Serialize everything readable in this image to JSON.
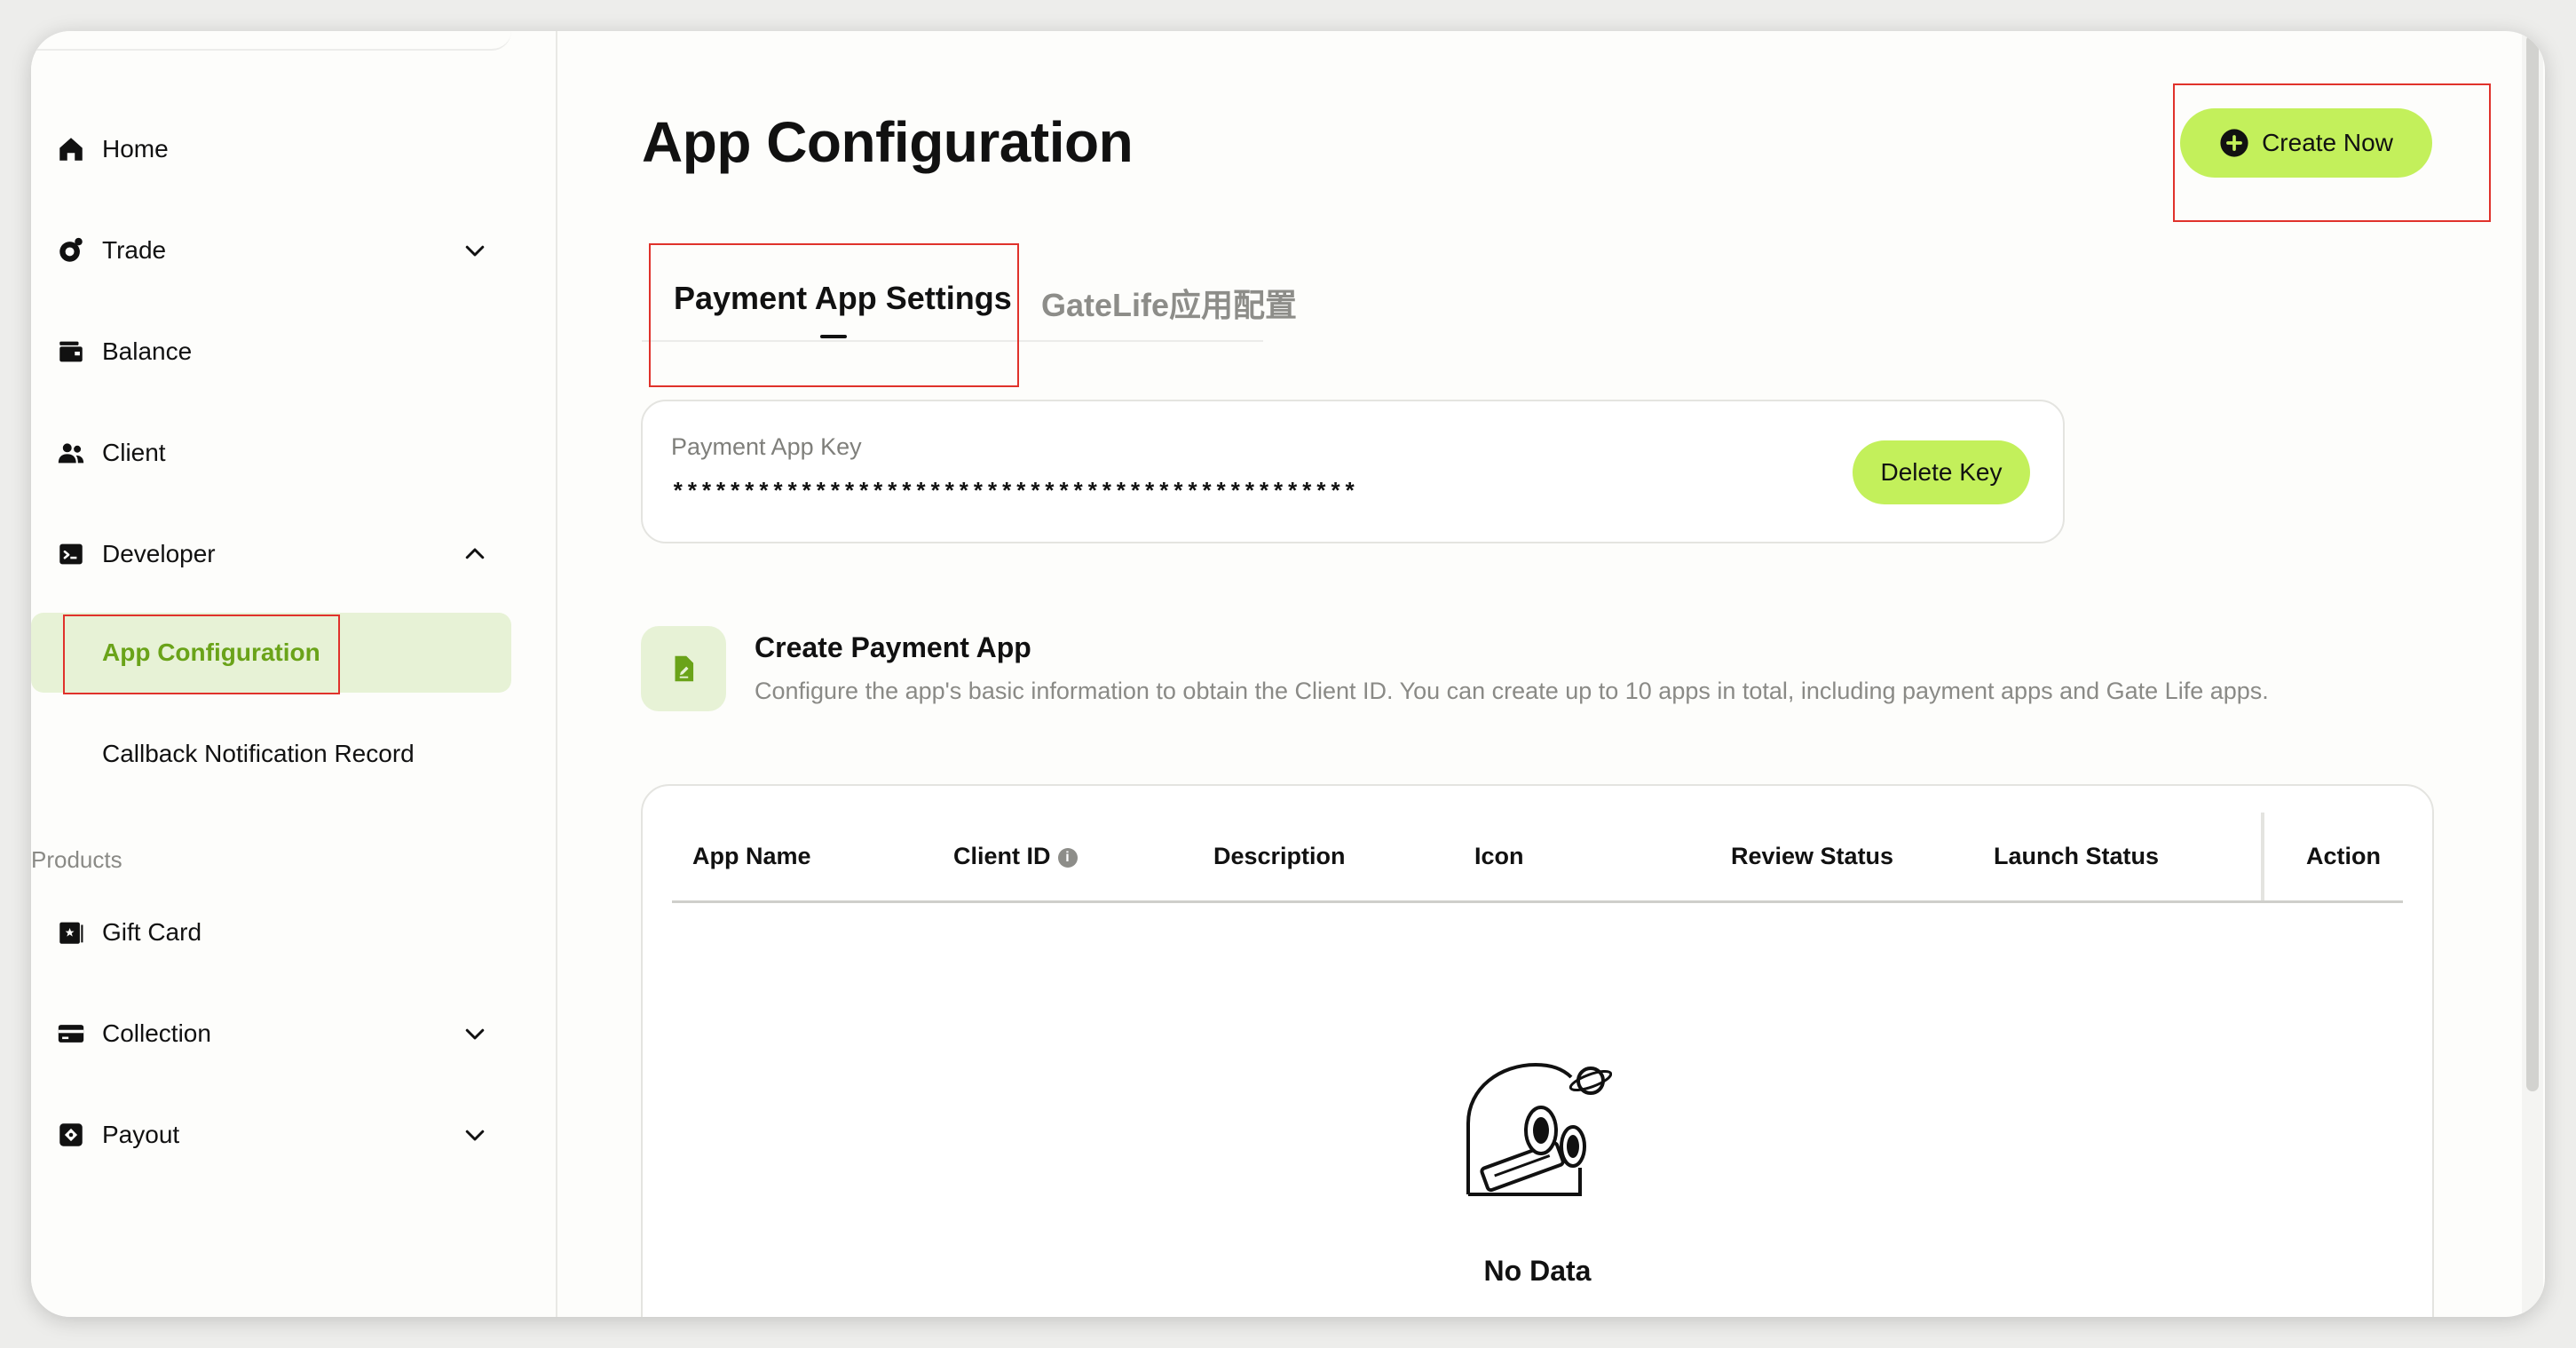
{
  "sidebar": {
    "items": [
      {
        "label": "Home",
        "icon": "home-icon"
      },
      {
        "label": "Trade",
        "icon": "trade-icon",
        "chevron": "chevron-down-icon"
      },
      {
        "label": "Balance",
        "icon": "wallet-icon"
      },
      {
        "label": "Client",
        "icon": "users-icon"
      },
      {
        "label": "Developer",
        "icon": "terminal-icon",
        "chevron": "chevron-up-icon"
      }
    ],
    "developer_sub": [
      {
        "label": "App Configuration",
        "active": true
      },
      {
        "label": "Callback Notification Record",
        "active": false
      }
    ],
    "products_label": "Products",
    "products": [
      {
        "label": "Gift Card",
        "icon": "gift-card-icon"
      },
      {
        "label": "Collection",
        "icon": "collection-icon",
        "chevron": "chevron-down-icon"
      },
      {
        "label": "Payout",
        "icon": "payout-icon",
        "chevron": "chevron-down-icon"
      }
    ]
  },
  "main": {
    "title": "App Configuration",
    "create_button": "Create Now",
    "tabs": [
      {
        "label": "Payment App Settings",
        "active": true
      },
      {
        "label": "GateLife应用配置",
        "active": false
      }
    ],
    "key_card": {
      "label": "Payment App Key",
      "value": "************************************************",
      "delete_button": "Delete Key"
    },
    "create_app": {
      "title": "Create Payment App",
      "description": "Configure the app's basic information to obtain the Client ID. You can create up to 10 apps in total, including payment apps and Gate Life apps."
    },
    "table": {
      "columns": [
        "App Name",
        "Client ID",
        "Description",
        "Icon",
        "Review Status",
        "Launch Status",
        "Action"
      ],
      "empty_text": "No Data"
    }
  },
  "colors": {
    "accent": "#c3f05b",
    "active_bg": "#e7f2d6",
    "active_text": "#6aa319",
    "highlight_box": "#e0322b"
  }
}
